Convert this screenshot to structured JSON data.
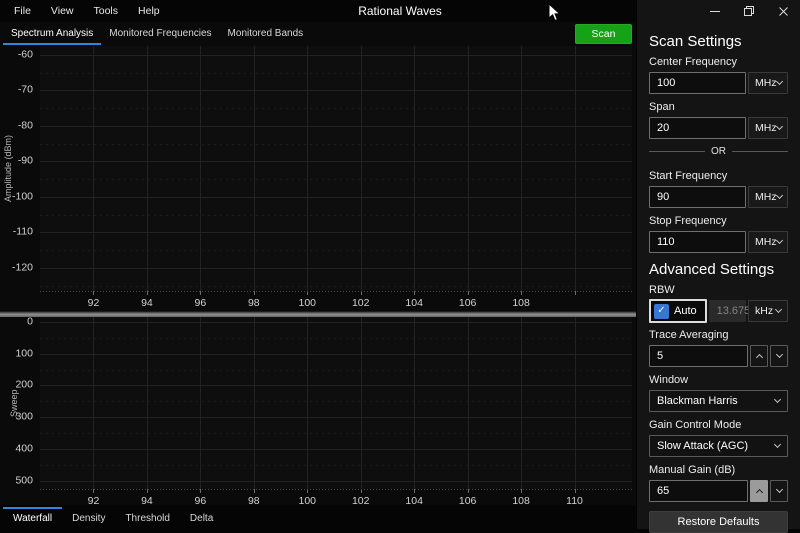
{
  "window": {
    "title": "Rational Waves"
  },
  "menu": {
    "items": [
      "File",
      "View",
      "Tools",
      "Help"
    ]
  },
  "tabs": {
    "items": [
      {
        "label": "Spectrum Analysis",
        "active": true
      },
      {
        "label": "Monitored Frequencies",
        "active": false
      },
      {
        "label": "Monitored Bands",
        "active": false
      }
    ]
  },
  "scan": {
    "label": "Scan"
  },
  "bottom_tabs": {
    "items": [
      "Waterfall",
      "Density",
      "Threshold",
      "Delta"
    ],
    "active_index": 0
  },
  "panel": {
    "title": "Scan Settings",
    "center_frequency": {
      "label": "Center Frequency",
      "value": "100",
      "unit": "MHz"
    },
    "span": {
      "label": "Span",
      "value": "20",
      "unit": "MHz"
    },
    "or_label": "OR",
    "start_frequency": {
      "label": "Start Frequency",
      "value": "90",
      "unit": "MHz"
    },
    "stop_frequency": {
      "label": "Stop Frequency",
      "value": "110",
      "unit": "MHz"
    },
    "advanced_title": "Advanced Settings",
    "rbw": {
      "label": "RBW",
      "auto_label": "Auto",
      "auto_checked": true,
      "value": "13.675",
      "unit": "kHz"
    },
    "trace_averaging": {
      "label": "Trace Averaging",
      "value": "5"
    },
    "window_function": {
      "label": "Window",
      "value": "Blackman Harris"
    },
    "gain_control_mode": {
      "label": "Gain Control Mode",
      "value": "Slow Attack (AGC)"
    },
    "manual_gain": {
      "label": "Manual Gain (dB)",
      "value": "65"
    },
    "restore_defaults_label": "Restore Defaults"
  },
  "colors": {
    "accent": "#2e86e0",
    "scan-green": "#16a216",
    "checkbox-blue": "#3876d3"
  },
  "chart_data": [
    {
      "type": "line",
      "title": "Spectrum Analysis",
      "xlabel": "",
      "ylabel": "Amplitude (dBm)",
      "xlim": [
        90,
        112.15
      ],
      "ylim": [
        -57.5,
        -126.5
      ],
      "x_gridlines": [
        92,
        94,
        96,
        98,
        100,
        102,
        104,
        106,
        108,
        110
      ],
      "x_tick_labels": [
        92,
        94,
        96,
        98,
        100,
        102,
        104,
        106,
        108
      ],
      "y_ticks": [
        -60,
        -70,
        -80,
        -90,
        -100,
        -110,
        -120
      ],
      "minor_y": 5,
      "grid": true,
      "legend": false,
      "series": []
    },
    {
      "type": "heatmap",
      "title": "Waterfall",
      "xlabel": "",
      "ylabel": "Sweep",
      "xlim": [
        90,
        112.15
      ],
      "ylim": [
        -15,
        525
      ],
      "x_gridlines": [
        92,
        94,
        96,
        98,
        100,
        102,
        104,
        106,
        108,
        110
      ],
      "x_tick_labels": [
        92,
        94,
        96,
        98,
        100,
        102,
        104,
        106,
        108,
        110
      ],
      "y_ticks": [
        0,
        100,
        200,
        300,
        400,
        500
      ],
      "minor_y": 50,
      "grid": true,
      "legend": false,
      "series": []
    }
  ]
}
